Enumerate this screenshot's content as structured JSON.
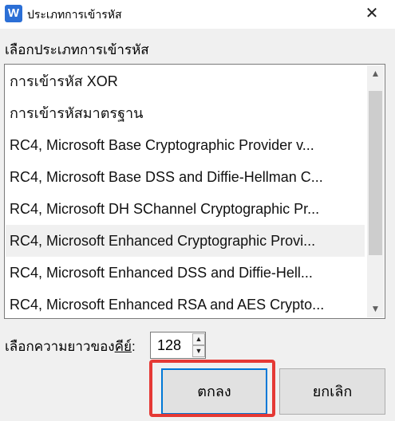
{
  "window": {
    "app_icon_letter": "W",
    "title": "ประเภทการเข้ารหัส",
    "close_glyph": "✕"
  },
  "encryption_list": {
    "label": "เลือกประเภทการเข้ารหัส",
    "items": [
      "การเข้ารหัส XOR",
      "การเข้ารหัสมาตรฐาน",
      "RC4, Microsoft Base Cryptographic Provider v...",
      "RC4, Microsoft Base DSS and Diffie-Hellman C...",
      "RC4, Microsoft DH SChannel Cryptographic Pr...",
      "RC4, Microsoft Enhanced Cryptographic Provi...",
      "RC4, Microsoft Enhanced DSS and Diffie-Hell...",
      "RC4, Microsoft Enhanced RSA and AES Crypto..."
    ],
    "selected_index": 5,
    "scroll_up_glyph": "▲",
    "scroll_down_glyph": "▼"
  },
  "key_length": {
    "label_prefix": "เลือกความยาวของ",
    "label_underlined": "คีย์",
    "label_suffix": ":",
    "value": "128",
    "up_glyph": "▲",
    "down_glyph": "▼"
  },
  "buttons": {
    "ok_label": "ตกลง",
    "cancel_label": "ยกเลิก"
  },
  "colors": {
    "highlight": "#e53935",
    "focus_border": "#0078d7",
    "app_icon": "#2b6fd6"
  }
}
